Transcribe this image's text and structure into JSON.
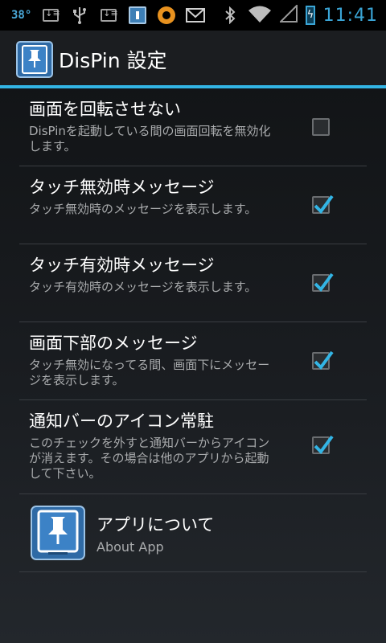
{
  "status_bar": {
    "temperature": "38°",
    "time": "11:41",
    "icons": [
      "download-icon",
      "usb-icon",
      "download-icon",
      "dispin-icon",
      "orange-circle-icon",
      "gmail-icon",
      "bluetooth-icon",
      "wifi-icon",
      "signal-icon",
      "battery-charging-icon"
    ]
  },
  "action_bar": {
    "title": "DisPin 設定",
    "icon": "dispin-app-icon"
  },
  "accent_color": "#33b5e5",
  "preferences": [
    {
      "title": "画面を回転させない",
      "summary": "DisPinを起動している間の画面回転を無効化します。",
      "checked": false
    },
    {
      "title": "タッチ無効時メッセージ",
      "summary": "タッチ無効時のメッセージを表示します。",
      "checked": true
    },
    {
      "title": "タッチ有効時メッセージ",
      "summary": "タッチ有効時のメッセージを表示します。",
      "checked": true
    },
    {
      "title": "画面下部のメッセージ",
      "summary": "タッチ無効になってる間、画面下にメッセージを表示します。",
      "checked": true
    },
    {
      "title": "通知バーのアイコン常駐",
      "summary": "このチェックを外すと通知バーからアイコンが消えます。その場合は他のアプリから起動して下さい。",
      "checked": true
    }
  ],
  "about": {
    "title": "アプリについて",
    "summary": "About App",
    "icon": "dispin-app-icon"
  }
}
